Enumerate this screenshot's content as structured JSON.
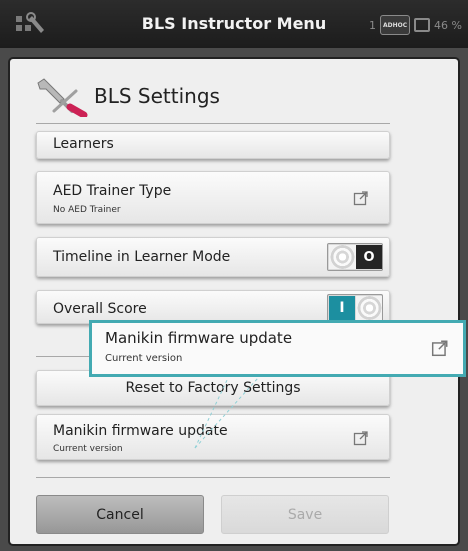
{
  "statusbar": {
    "title": "BLS Instructor Menu",
    "count": "1",
    "adhoc": "ADHOC",
    "battery": "46 %",
    "icons": [
      "settings-tools-icon",
      "adhoc-network-icon",
      "screen-icon"
    ]
  },
  "dialog": {
    "title": "BLS Settings",
    "icon": "tools-icon",
    "rows": {
      "learners": {
        "label": "Learners"
      },
      "aed": {
        "label": "AED Trainer Type",
        "sub": "No AED Trainer",
        "icon": "external-link-icon"
      },
      "timeline": {
        "label": "Timeline in Learner Mode",
        "toggle": "O",
        "state": "off"
      },
      "overall": {
        "label": "Overall Score",
        "toggle": "I",
        "state": "on"
      },
      "reset": {
        "label": "Reset to Factory Settings"
      },
      "firmware": {
        "label": "Manikin firmware update",
        "sub": "Current version",
        "icon": "external-link-icon"
      }
    },
    "buttons": {
      "cancel": "Cancel",
      "save": "Save"
    }
  },
  "callout": {
    "label": "Manikin firmware update",
    "sub": "Current version",
    "icon": "external-link-icon",
    "accent": "#43aab2"
  },
  "colors": {
    "accent": "#1c8fa0",
    "background": "#4a4a4a",
    "dialog": "#efefef"
  }
}
